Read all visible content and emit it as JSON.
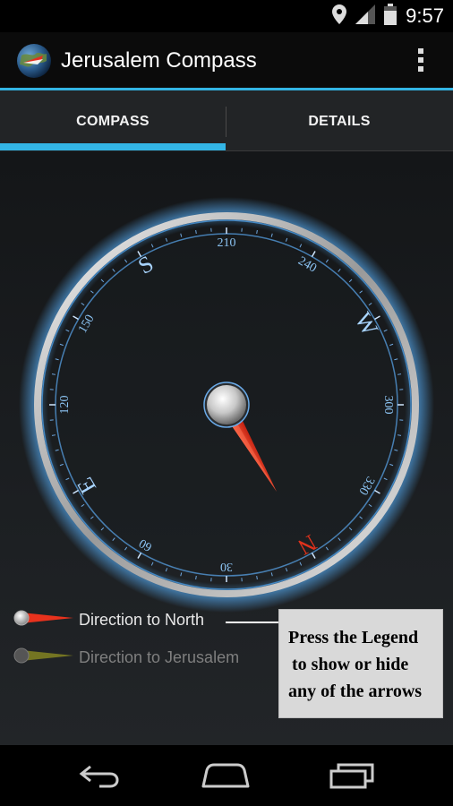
{
  "status_bar": {
    "time": "9:57",
    "icons": [
      "location-icon",
      "signal-icon",
      "battery-icon"
    ]
  },
  "action_bar": {
    "title": "Jerusalem Compass",
    "app_icon": "globe-icon",
    "overflow_icon": "overflow-menu-icon"
  },
  "tabs": [
    {
      "label": "COMPASS",
      "selected": true
    },
    {
      "label": "DETAILS",
      "selected": false
    }
  ],
  "compass": {
    "degree_labels": [
      "210",
      "240",
      "300",
      "330",
      "30",
      "60",
      "120",
      "150"
    ],
    "cardinal_labels": [
      "S",
      "W",
      "N",
      "E"
    ],
    "north_cardinal_color": "#e0321c",
    "north_needle_heading_on_screen_deg": 150
  },
  "legend": [
    {
      "label": "Direction to North",
      "color": "#e8321d",
      "visible": true
    },
    {
      "label": "Direction to Jerusalem",
      "color": "#b8b82a",
      "visible": false
    }
  ],
  "callout": {
    "lines": [
      "Press the Legend",
      "to show or hide",
      "any of the arrows"
    ]
  },
  "nav_bar": {
    "icons": [
      "back-icon",
      "home-icon",
      "recents-icon"
    ]
  },
  "colors": {
    "accent": "#33b5e5",
    "dial_glow": "#5ab4ff"
  }
}
